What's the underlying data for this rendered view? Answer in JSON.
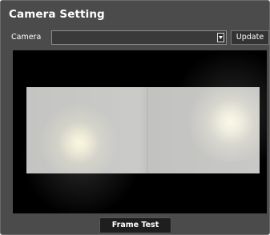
{
  "panel": {
    "title": "Camera Setting"
  },
  "camera": {
    "label": "Camera",
    "selected_value": "",
    "dropdown_icon": "chevron-down-icon"
  },
  "buttons": {
    "update_label": "Update",
    "frame_test_label": "Frame Test"
  },
  "preview": {
    "description_colors": {
      "background": "#000000",
      "card": "#c8c8c6",
      "highlight": "#fbf7df"
    }
  }
}
